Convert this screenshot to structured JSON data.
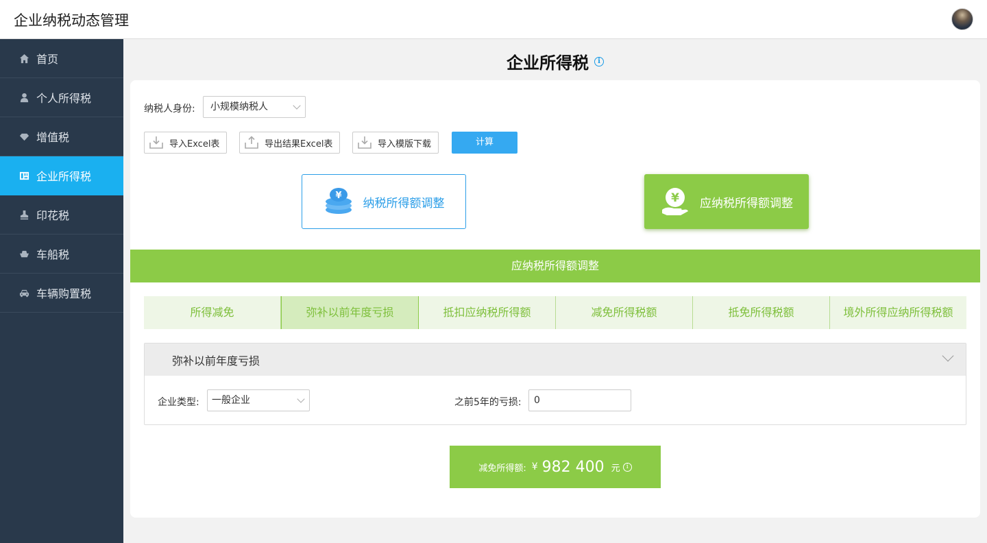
{
  "app": {
    "title": "企业纳税动态管理"
  },
  "sidebar": {
    "items": [
      {
        "label": "首页",
        "icon": "home-icon"
      },
      {
        "label": "个人所得税",
        "icon": "user-icon"
      },
      {
        "label": "增值税",
        "icon": "diamond-icon"
      },
      {
        "label": "企业所得税",
        "icon": "building-icon",
        "active": true
      },
      {
        "label": "印花税",
        "icon": "stamp-icon"
      },
      {
        "label": "车船税",
        "icon": "boat-icon"
      },
      {
        "label": "车辆购置税",
        "icon": "car-icon"
      }
    ]
  },
  "page": {
    "title": "企业所得税",
    "info_glyph": "i"
  },
  "form": {
    "identity_label": "纳税人身份:",
    "identity_value": "小规模纳税人"
  },
  "toolbar": {
    "import_excel": "导入Excel表",
    "export_excel": "导出结果Excel表",
    "template_download": "导入模版下载",
    "calculate": "计算"
  },
  "modes": {
    "left": "纳税所得额调整",
    "right": "应纳税所得额调整"
  },
  "section": {
    "title": "应纳税所得额调整"
  },
  "tabs": [
    {
      "label": "所得减免"
    },
    {
      "label": "弥补以前年度亏损",
      "active": true
    },
    {
      "label": "抵扣应纳税所得额"
    },
    {
      "label": "减免所得税额"
    },
    {
      "label": "抵免所得税额"
    },
    {
      "label": "境外所得应纳所得税额"
    }
  ],
  "panel": {
    "title": "弥补以前年度亏损",
    "enterprise_type_label": "企业类型:",
    "enterprise_type_value": "一般企业",
    "loss_label": "之前5年的亏损:",
    "loss_value": "0"
  },
  "result": {
    "label": "减免所得额:",
    "currency": "¥",
    "amount": "982 400",
    "unit": "元",
    "info_glyph": "i"
  },
  "colors": {
    "sidebar_bg": "#29394b",
    "active_nav": "#1ab0f0",
    "green": "#8ccb47",
    "blue": "#35a9f1"
  }
}
